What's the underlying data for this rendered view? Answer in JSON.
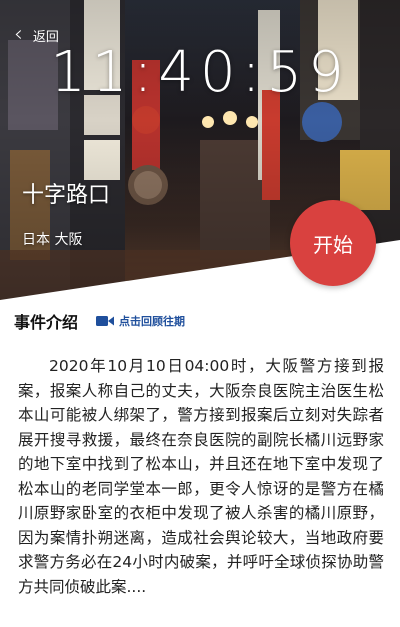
{
  "header": {
    "back_label": "返回",
    "clock": "11:40:59"
  },
  "location": {
    "name": "十字路口",
    "region": "日本 大阪"
  },
  "start_button": {
    "label": "开始",
    "color": "#d9413f"
  },
  "intro": {
    "title": "事件介绍",
    "replay_label": "点击回顾往期",
    "replay_color": "#1f4f9c",
    "body": "2020年10月10日04:00时，大阪警方接到报案，报案人称自己的丈夫，大阪奈良医院主治医生松本山可能被人绑架了，警方接到报案后立刻对失踪者展开搜寻救援，最终在奈良医院的副院长橘川远野家的地下室中找到了松本山，并且还在地下室中发现了松本山的老同学堂本一郎，更令人惊讶的是警方在橘川原野家卧室的衣柜中发现了被人杀害的橘川原野，因为案情扑朔迷离，造成社会舆论较大，当地政府要求警方务必在24小时内破案，并呼吁全球侦探协助警方共同侦破此案...."
  },
  "icons": {
    "back": "chevron-left-icon",
    "video": "video-camera-icon"
  }
}
